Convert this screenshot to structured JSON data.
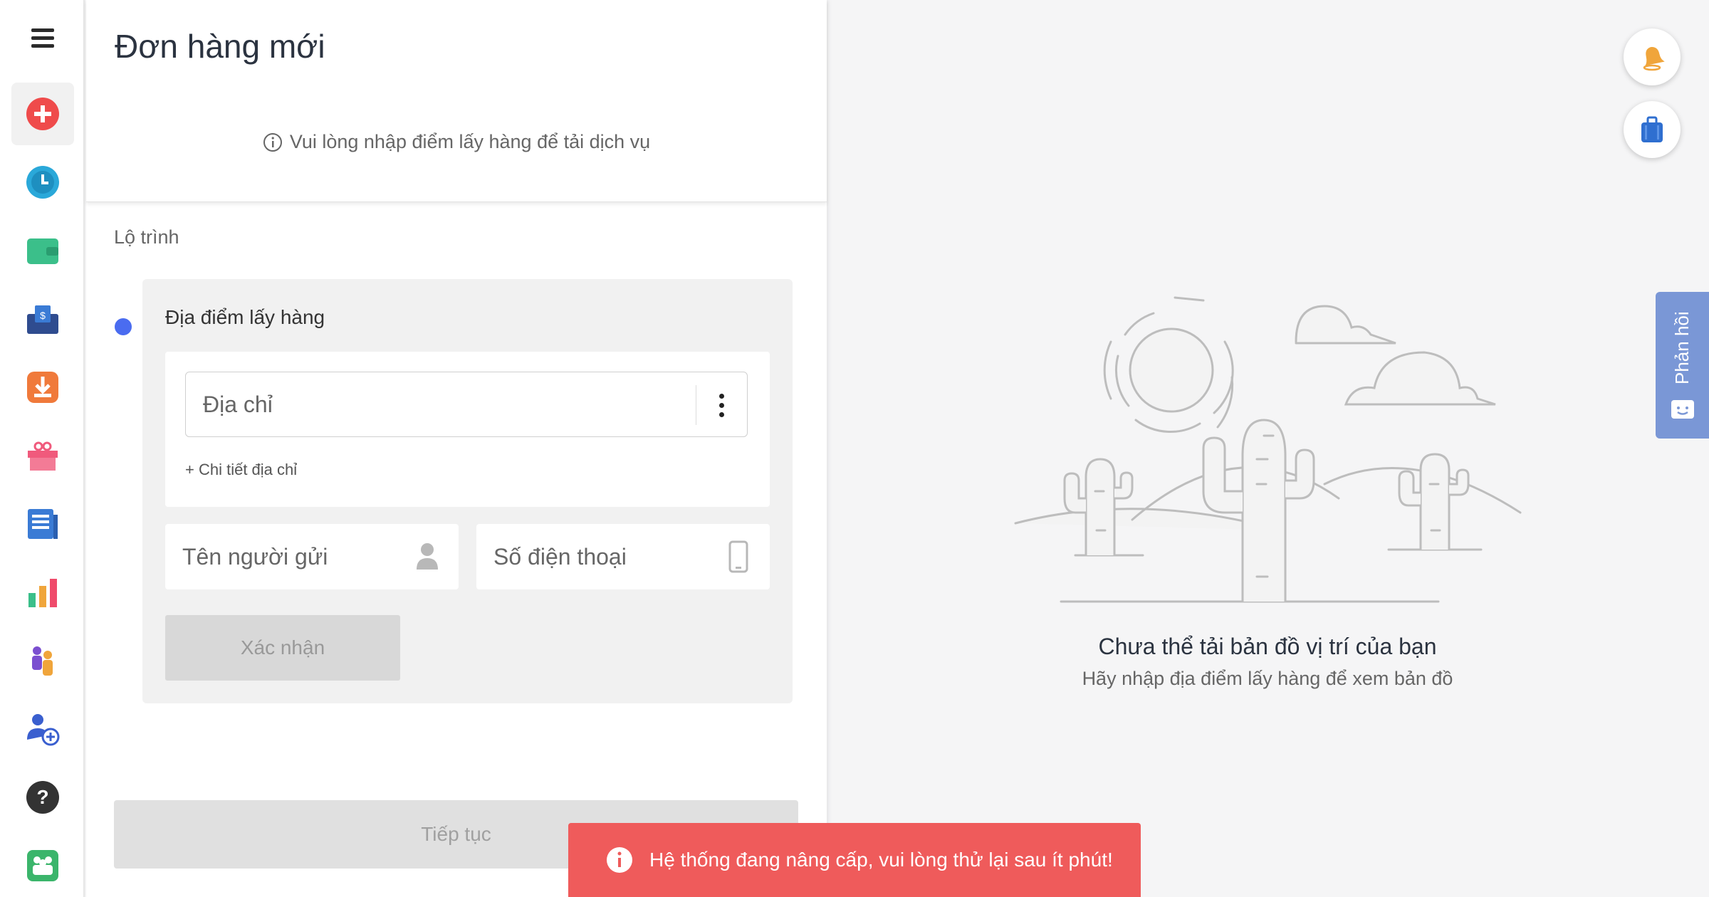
{
  "app": {
    "page_title": "Đơn hàng mới",
    "info_note": "Vui lòng nhập điểm lấy hàng để tải dịch vụ"
  },
  "sidebar": {
    "items": [
      {
        "icon": "add-order-icon",
        "color": "#ef4b4b",
        "active": true
      },
      {
        "icon": "clock-icon",
        "color": "#2aa8d9"
      },
      {
        "icon": "wallet-icon",
        "color": "#3bbf8a"
      },
      {
        "icon": "money-envelope-icon",
        "color": "#2f4c8f"
      },
      {
        "icon": "download-icon",
        "color": "#f07a3b"
      },
      {
        "icon": "gift-icon",
        "color": "#f05a7c"
      },
      {
        "icon": "report-icon",
        "color": "#3a7bd5"
      },
      {
        "icon": "bar-chart-icon",
        "color": "#f0a53b"
      },
      {
        "icon": "people-icon",
        "color": "#7b4fd0"
      },
      {
        "icon": "add-user-icon",
        "color": "#3a5fcf"
      },
      {
        "icon": "help-icon",
        "color": "#333333"
      },
      {
        "icon": "team-icon",
        "color": "#3bb56b"
      }
    ]
  },
  "route": {
    "section_label": "Lộ trình",
    "pickup_title": "Địa điểm lấy hàng",
    "address_placeholder": "Địa chỉ",
    "address_detail_link": "+ Chi tiết địa chỉ",
    "sender_placeholder": "Tên người gửi",
    "phone_placeholder": "Số điện thoại",
    "confirm_label": "Xác nhận"
  },
  "footer": {
    "continue_label": "Tiếp tục"
  },
  "map": {
    "title": "Chưa thể tải bản đồ vị trí của bạn",
    "subtitle": "Hãy nhập địa điểm lấy hàng để xem bản đồ"
  },
  "feedback": {
    "label": "Phản hồi"
  },
  "toast": {
    "message": "Hệ thống đang nâng cấp, vui lòng thử lại sau ít phút!",
    "color": "#ef5b5b"
  }
}
